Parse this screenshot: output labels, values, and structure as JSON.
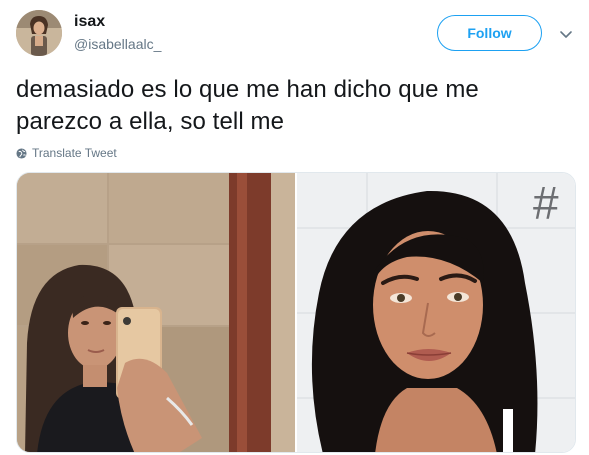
{
  "author": {
    "display_name": "isax",
    "handle": "@isabellaalc_"
  },
  "actions": {
    "follow_label": "Follow"
  },
  "tweet": {
    "text_line1": "demasiado es lo que me han dicho que me",
    "text_line2": "parezco a ella, so tell me"
  },
  "translate": {
    "label": "Translate Tweet"
  },
  "colors": {
    "accent": "#1da1f2",
    "secondary_text": "#657786",
    "primary_text": "#14171a"
  },
  "icons": {
    "caret": "chevron-down-icon",
    "translate": "globe-icon"
  },
  "media": {
    "right_photo_text": "#"
  }
}
